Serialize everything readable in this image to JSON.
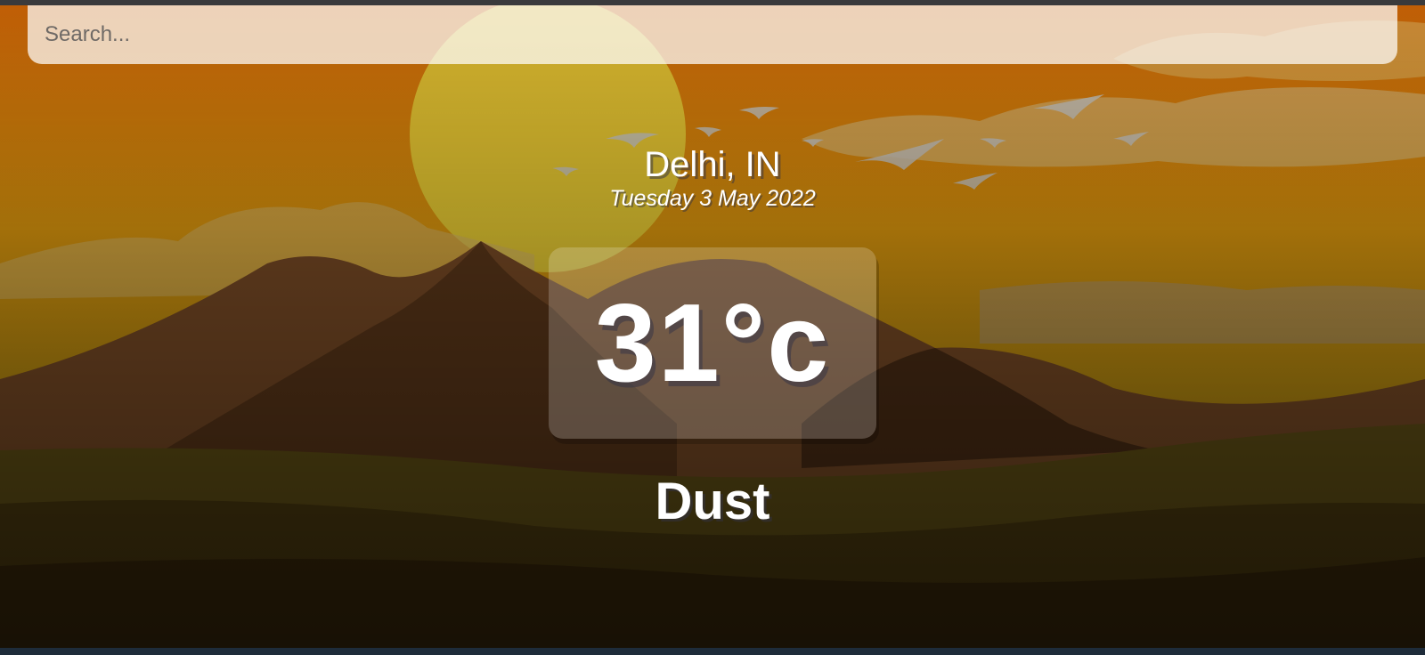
{
  "search": {
    "placeholder": "Search...",
    "value": ""
  },
  "location": {
    "city": "Delhi, IN",
    "date": "Tuesday 3 May 2022"
  },
  "temperature": {
    "value": "31°c"
  },
  "weather": {
    "condition": "Dust"
  },
  "colors": {
    "sky_top": "#c0610a",
    "sky_mid": "#d49a12",
    "sun": "#d8c53a",
    "mountain": "#6b4423",
    "ground": "#3a2a10"
  }
}
